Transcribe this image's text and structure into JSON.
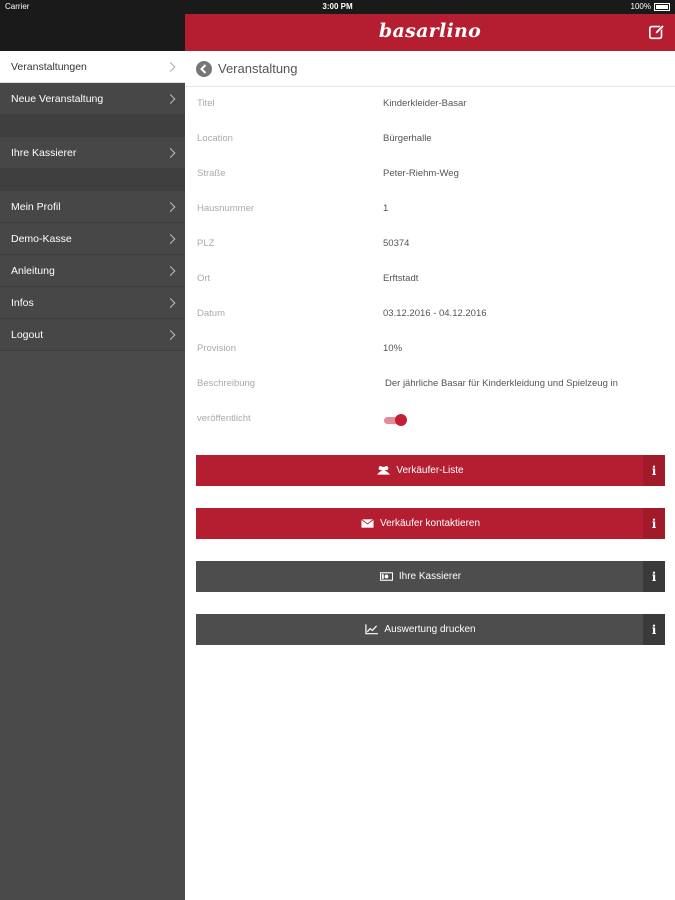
{
  "status": {
    "carrier": "Carrier",
    "time": "3:00 PM",
    "battery": "100%"
  },
  "app": {
    "logo": "basarlino"
  },
  "sidebar": {
    "items": [
      {
        "label": "Veranstaltungen",
        "active": true
      },
      {
        "label": "Neue Veranstaltung"
      },
      {
        "label": "Ihre Kassierer"
      },
      {
        "label": "Mein Profil"
      },
      {
        "label": "Demo-Kasse"
      },
      {
        "label": "Anleitung"
      },
      {
        "label": "Infos"
      },
      {
        "label": "Logout"
      }
    ]
  },
  "page": {
    "title": "Veranstaltung"
  },
  "fields": [
    {
      "label": "Titel",
      "value": "Kinderkleider-Basar"
    },
    {
      "label": "Location",
      "value": "Bürgerhalle"
    },
    {
      "label": "Straße",
      "value": "Peter-Riehm-Weg"
    },
    {
      "label": "Hausnummer",
      "value": "1"
    },
    {
      "label": "PLZ",
      "value": "50374"
    },
    {
      "label": "Ort",
      "value": "Erftstadt"
    },
    {
      "label": "Datum",
      "value": "03.12.2016 - 04.12.2016"
    },
    {
      "label": "Provision",
      "value": "10%"
    },
    {
      "label": "Beschreibung",
      "value": "Der jährliche Basar für Kinderkleidung und Spielzeug in"
    },
    {
      "label": "veröffentlicht",
      "value": true
    }
  ],
  "actions": [
    {
      "label": "Verkäufer-Liste",
      "icon": "users-icon",
      "style": "red"
    },
    {
      "label": "Verkäufer kontaktieren",
      "icon": "mail-icon",
      "style": "red"
    },
    {
      "label": "Ihre Kassierer",
      "icon": "cash-icon",
      "style": "dark"
    },
    {
      "label": "Auswertung drucken",
      "icon": "chart-icon",
      "style": "dark"
    }
  ],
  "info_label": "i",
  "colors": {
    "brand": "#b51e30",
    "sidebar": "#474747",
    "dark_button": "#4d4d4d"
  }
}
